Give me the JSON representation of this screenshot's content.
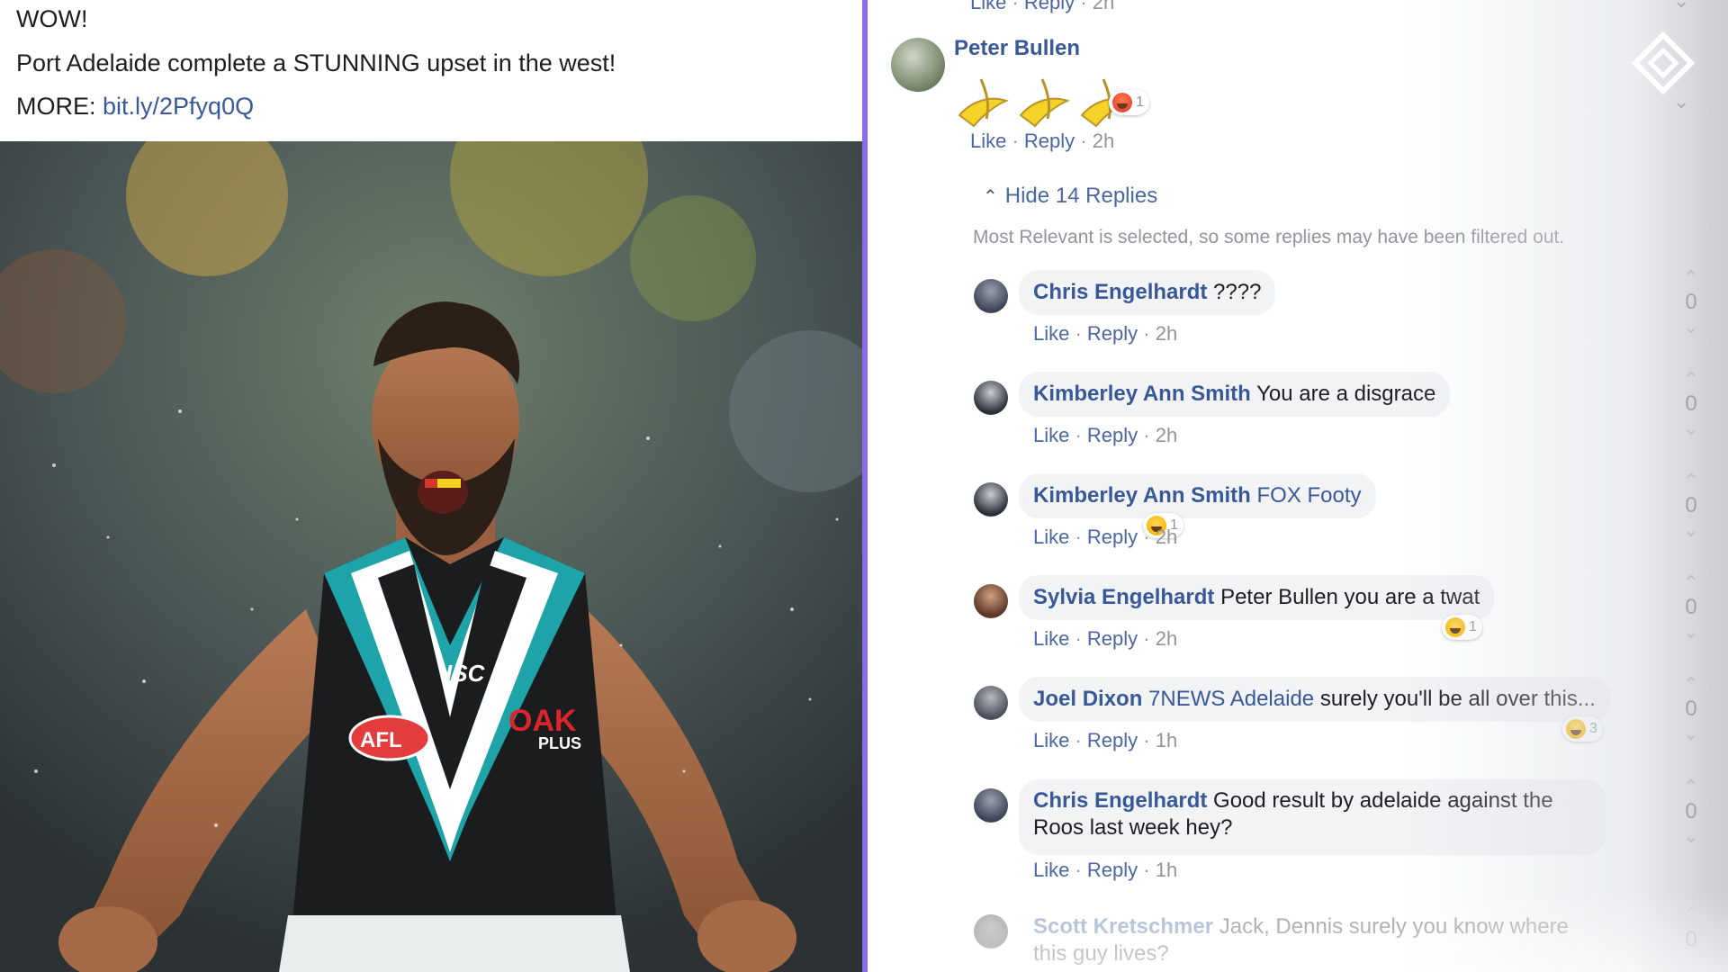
{
  "post": {
    "line1": "WOW!",
    "line2": "Port Adelaide complete a STUNNING upset in the west!",
    "line3_prefix": "MORE: ",
    "link": "bit.ly/2Pfyq0Q",
    "photo": {
      "jersey_logo": "ISC",
      "badge": "AFL",
      "sponsor": "OAK",
      "sponsor_sub": "PLUS"
    }
  },
  "comments_panel": {
    "top_meta": {
      "like": "Like",
      "reply": "Reply",
      "time": "2h"
    },
    "peter": {
      "name": "Peter Bullen",
      "reaction_count": "1",
      "like": "Like",
      "reply": "Reply",
      "time": "2h"
    },
    "hide_replies": "Hide 14 Replies",
    "filter_notice": "Most Relevant is selected, so some replies may have been filtered out.",
    "replies": [
      {
        "name": "Chris Engelhardt",
        "text": "????",
        "like": "Like",
        "reply": "Reply",
        "time": "2h",
        "votes": "0",
        "reactions": ""
      },
      {
        "name": "Kimberley Ann Smith",
        "text": "You are a disgrace",
        "like": "Like",
        "reply": "Reply",
        "time": "2h",
        "votes": "0",
        "reactions": ""
      },
      {
        "name": "Kimberley Ann Smith",
        "text": "",
        "mention": "FOX Footy",
        "like": "Like",
        "reply": "Reply",
        "time": "2h",
        "votes": "0",
        "reactions": "1"
      },
      {
        "name": "Sylvia Engelhardt",
        "text": "Peter Bullen you are a twat",
        "like": "Like",
        "reply": "Reply",
        "time": "2h",
        "votes": "0",
        "reactions": "1"
      },
      {
        "name": "Joel Dixon",
        "mention": "7NEWS Adelaide",
        "text": "surely you'll be all over this...",
        "like": "Like",
        "reply": "Reply",
        "time": "1h",
        "votes": "0",
        "reactions": "3"
      },
      {
        "name": "Chris Engelhardt",
        "text": "Good result by adelaide against the Roos last week hey?",
        "like": "Like",
        "reply": "Reply",
        "time": "1h",
        "votes": "0",
        "reactions": ""
      },
      {
        "name": "Scott Kretschmer",
        "text": "Jack, Dennis surely you know where this guy lives?",
        "votes": "0"
      }
    ]
  },
  "colors": {
    "link": "#385898",
    "divider": "#8a6be8",
    "bubble": "#f2f3f5"
  },
  "icons": [
    "avatar",
    "banana-emoji",
    "angry-emoji",
    "laugh-emoji",
    "chevron-up-icon",
    "upvote-icon",
    "downvote-icon",
    "brand-logo-icon"
  ]
}
